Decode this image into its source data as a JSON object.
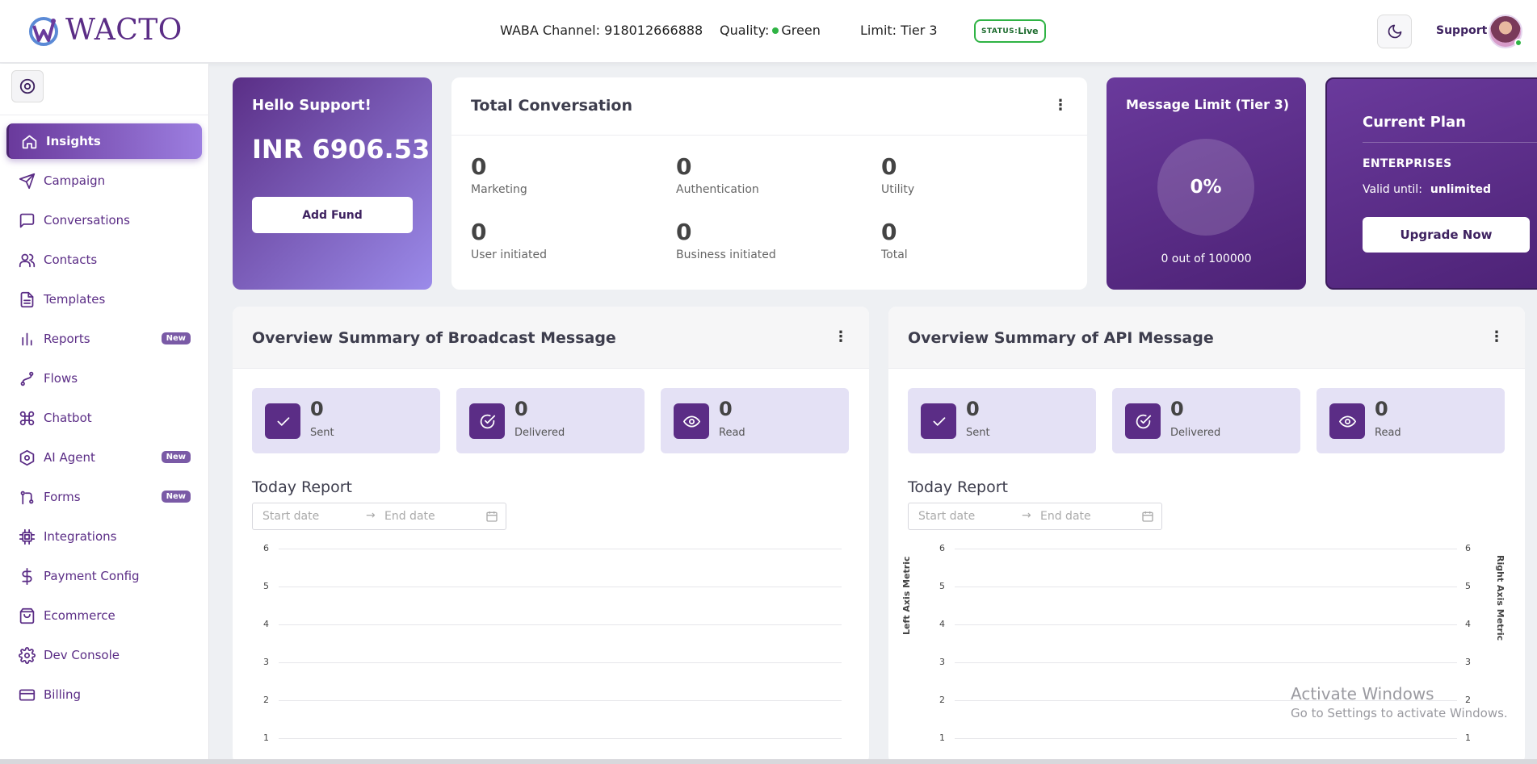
{
  "header": {
    "brand": "WACTO",
    "waba_channel_label": "WABA Channel:",
    "waba_channel_value": "918012666888",
    "quality_label": "Quality:",
    "quality_value": "Green",
    "limit_label": "Limit:",
    "limit_value": "Tier 3",
    "status_label": "STATUS:",
    "status_value": "Live",
    "user_name": "Support",
    "colors": {
      "brand": "#5b2d86",
      "status_green": "#2fb344"
    }
  },
  "sidebar": {
    "items": [
      {
        "label": "Insights",
        "icon": "home-icon",
        "active": true
      },
      {
        "label": "Campaign",
        "icon": "send-icon"
      },
      {
        "label": "Conversations",
        "icon": "message-icon"
      },
      {
        "label": "Contacts",
        "icon": "users-icon"
      },
      {
        "label": "Templates",
        "icon": "file-icon"
      },
      {
        "label": "Reports",
        "icon": "bar-chart-icon",
        "badge": "New"
      },
      {
        "label": "Flows",
        "icon": "flow-icon"
      },
      {
        "label": "Chatbot",
        "icon": "command-icon"
      },
      {
        "label": "AI Agent",
        "icon": "ai-icon",
        "badge": "New"
      },
      {
        "label": "Forms",
        "icon": "git-icon",
        "badge": "New"
      },
      {
        "label": "Integrations",
        "icon": "chip-icon"
      },
      {
        "label": "Payment Config",
        "icon": "dollar-icon"
      },
      {
        "label": "Ecommerce",
        "icon": "shopping-bag-icon"
      },
      {
        "label": "Dev Console",
        "icon": "gear-icon"
      },
      {
        "label": "Billing",
        "icon": "credit-card-icon"
      }
    ]
  },
  "wallet": {
    "greeting": "Hello Support!",
    "balance": "INR 6906.53",
    "add_fund_label": "Add Fund"
  },
  "conversation": {
    "title": "Total Conversation",
    "stats": [
      {
        "value": "0",
        "label": "Marketing"
      },
      {
        "value": "0",
        "label": "Authentication"
      },
      {
        "value": "0",
        "label": "Utility"
      },
      {
        "value": "0",
        "label": "User initiated"
      },
      {
        "value": "0",
        "label": "Business initiated"
      },
      {
        "value": "0",
        "label": "Total"
      }
    ]
  },
  "message_limit": {
    "title": "Message Limit (Tier 3)",
    "percent": "0%",
    "footer": "0 out of 100000"
  },
  "plan": {
    "title": "Current Plan",
    "tier": "ENTERPRISES",
    "valid_label": "Valid until:",
    "valid_value": "unlimited",
    "upgrade_label": "Upgrade Now"
  },
  "broadcast": {
    "title": "Overview Summary of Broadcast Message",
    "cards": [
      {
        "value": "0",
        "label": "Sent",
        "icon": "check-icon"
      },
      {
        "value": "0",
        "label": "Delivered",
        "icon": "check-circle-icon"
      },
      {
        "value": "0",
        "label": "Read",
        "icon": "eye-icon"
      }
    ],
    "report_title": "Today Report",
    "start_placeholder": "Start date",
    "end_placeholder": "End date"
  },
  "api": {
    "title": "Overview Summary of API Message",
    "cards": [
      {
        "value": "0",
        "label": "Sent",
        "icon": "check-icon"
      },
      {
        "value": "0",
        "label": "Delivered",
        "icon": "check-circle-icon"
      },
      {
        "value": "0",
        "label": "Read",
        "icon": "eye-icon"
      }
    ],
    "report_title": "Today Report",
    "start_placeholder": "Start date",
    "end_placeholder": "End date"
  },
  "chart_data": [
    {
      "type": "line",
      "title": "",
      "xlabel": "",
      "ylabel": "",
      "yticks": [
        "6",
        "5",
        "4",
        "3",
        "2",
        "1"
      ],
      "ylim": [
        1,
        6
      ],
      "series": []
    },
    {
      "type": "line",
      "title": "",
      "xlabel": "",
      "ylabel": "Left Axis Metric",
      "y2label": "Right Axis Metric",
      "yticks": [
        "6",
        "5",
        "4",
        "3",
        "2",
        "1"
      ],
      "y2ticks": [
        "6",
        "5",
        "4",
        "3",
        "2",
        "1"
      ],
      "ylim": [
        1,
        6
      ],
      "series": []
    }
  ],
  "watermark": {
    "line1": "Activate Windows",
    "line2": "Go to Settings to activate Windows."
  }
}
